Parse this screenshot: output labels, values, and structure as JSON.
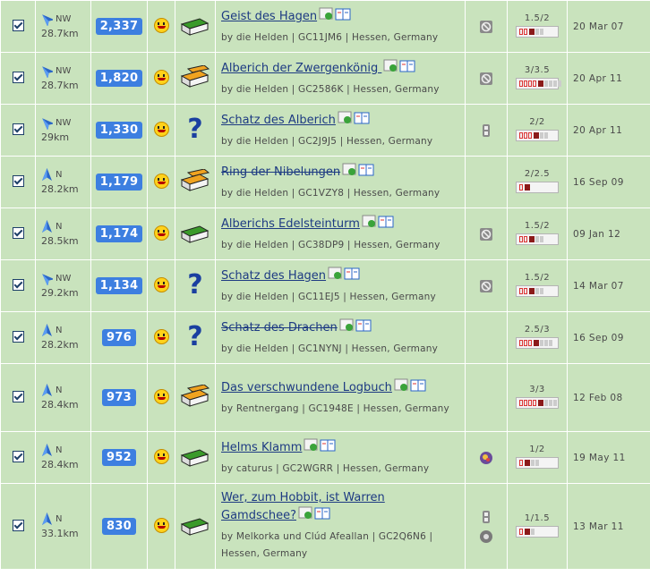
{
  "rows": [
    {
      "dir": "NW",
      "dist": "28.7km",
      "count": "2,337",
      "type": "traditional",
      "name": "Geist des Hagen",
      "strike": false,
      "owner": "by die Helden | GC11JM6 | Hessen, Germany",
      "attrs": [
        "no-pets-icon"
      ],
      "dt": "1.5/2",
      "dlevel": 2,
      "tlevel": 3,
      "date": "20 Mar 07"
    },
    {
      "dir": "NW",
      "dist": "28.7km",
      "count": "1,820",
      "type": "multi",
      "name": "Alberich der Zwergenkönig ",
      "strike": false,
      "owner": "by die Helden | GC2586K | Hessen, Germany",
      "attrs": [
        "no-pets-icon"
      ],
      "dt": "3/3.5",
      "dlevel": 4,
      "tlevel": 5,
      "date": "20 Apr 11"
    },
    {
      "dir": "NW",
      "dist": "29km",
      "count": "1,330",
      "type": "mystery",
      "name": "Schatz des Alberich",
      "strike": false,
      "owner": "by die Helden | GC2J9J5 | Hessen, Germany",
      "attrs": [
        "flashlight-icon"
      ],
      "dt": "2/2",
      "dlevel": 3,
      "tlevel": 3,
      "date": "20 Apr 11"
    },
    {
      "dir": "N",
      "dist": "28.2km",
      "count": "1,179",
      "type": "multi",
      "name": "Ring der Nibelungen",
      "strike": true,
      "owner": "by die Helden | GC1VZY8 | Hessen, Germany",
      "attrs": [],
      "dt": "2/2.5",
      "dlevel": 1,
      "tlevel": 1,
      "date": "16 Sep 09"
    },
    {
      "dir": "N",
      "dist": "28.5km",
      "count": "1,174",
      "type": "traditional",
      "name": "Alberichs Edelsteinturm",
      "strike": false,
      "owner": "by die Helden | GC38DP9 | Hessen, Germany",
      "attrs": [
        "no-pets-icon"
      ],
      "dt": "1.5/2",
      "dlevel": 2,
      "tlevel": 3,
      "date": "09 Jan 12"
    },
    {
      "dir": "NW",
      "dist": "29.2km",
      "count": "1,134",
      "type": "mystery",
      "name": "Schatz des Hagen",
      "strike": false,
      "owner": "by die Helden | GC11EJ5 | Hessen, Germany",
      "attrs": [
        "no-pets-icon"
      ],
      "dt": "1.5/2",
      "dlevel": 2,
      "tlevel": 3,
      "date": "14 Mar 07"
    },
    {
      "dir": "N",
      "dist": "28.2km",
      "count": "976",
      "type": "mystery",
      "name": "Schatz des Drachen",
      "strike": true,
      "owner": "by die Helden | GC1NYNJ | Hessen, Germany",
      "attrs": [],
      "dt": "2.5/3",
      "dlevel": 3,
      "tlevel": 4,
      "date": "16 Sep 09"
    },
    {
      "dir": "N",
      "dist": "28.4km",
      "count": "973",
      "type": "multi",
      "name": "Das verschwundene Logbuch",
      "strike": false,
      "owner": "by Rentnergang | GC1948E | Hessen, Germany",
      "attrs": [],
      "dt": "3/3",
      "dlevel": 4,
      "tlevel": 4,
      "date": "12 Feb 08"
    },
    {
      "dir": "N",
      "dist": "28.4km",
      "count": "952",
      "type": "traditional",
      "name": "Helms Klamm",
      "strike": false,
      "owner": "by caturus | GC2WGRR | Hessen, Germany",
      "attrs": [
        "kids-icon"
      ],
      "dt": "1/2",
      "dlevel": 1,
      "tlevel": 3,
      "date": "19 May 11"
    },
    {
      "dir": "N",
      "dist": "33.1km",
      "count": "830",
      "type": "traditional",
      "name": "Wer, zum Hobbit, ist Warren Gamdschee?",
      "strike": false,
      "owner": "by Melkorka und Clúd Afeallan | GC2Q6N6 | Hessen, Germany",
      "attrs": [
        "flashlight-icon",
        "wheel-icon"
      ],
      "dt": "1/1.5",
      "dlevel": 1,
      "tlevel": 2,
      "date": "13 Mar 11"
    }
  ],
  "colors": {
    "row": "#c9e3bd",
    "link": "#1d3a82",
    "count": "#3d7fe0",
    "dark_red": "#8b1a1a"
  }
}
